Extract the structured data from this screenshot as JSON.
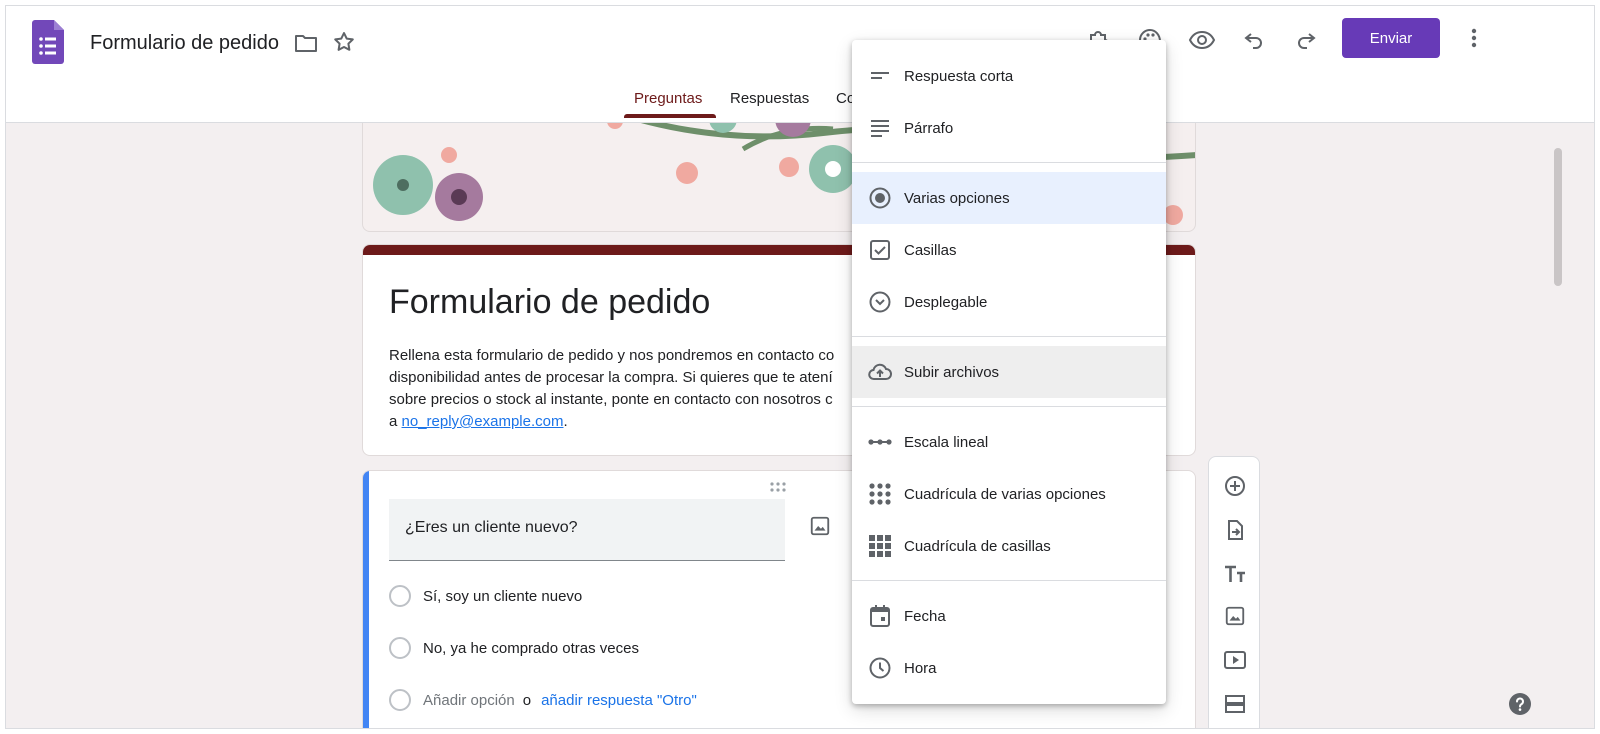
{
  "header": {
    "doc_title": "Formulario de pedido",
    "send_label": "Enviar"
  },
  "tabs": [
    {
      "label": "Preguntas"
    },
    {
      "label": "Respuestas"
    },
    {
      "label": "Co"
    }
  ],
  "form": {
    "title": "Formulario de pedido",
    "description_lines": [
      "Rellena esta formulario de pedido y nos pondremos en contacto co",
      "disponibilidad antes de procesar la compra. Si quieres que te atení",
      "sobre precios o stock al instante, ponte en contacto con nosotros c"
    ],
    "description_prefix": "a ",
    "email": "no_reply@example.com",
    "description_suffix": "."
  },
  "question": {
    "title": "¿Eres un cliente nuevo?",
    "options": [
      "Sí, soy un cliente nuevo",
      "No, ya he comprado otras veces"
    ],
    "add_option": "Añadir opción",
    "or": "o",
    "add_other": "añadir respuesta \"Otro\""
  },
  "menu": {
    "items": [
      {
        "label": "Respuesta corta",
        "icon": "short-answer-icon"
      },
      {
        "label": "Párrafo",
        "icon": "paragraph-icon"
      },
      {
        "label": "Varias opciones",
        "icon": "radio-icon",
        "selected": true
      },
      {
        "label": "Casillas",
        "icon": "checkbox-icon"
      },
      {
        "label": "Desplegable",
        "icon": "dropdown-icon"
      },
      {
        "label": "Subir archivos",
        "icon": "cloud-upload-icon",
        "hover": true
      },
      {
        "label": "Escala lineal",
        "icon": "linear-scale-icon"
      },
      {
        "label": "Cuadrícula de varias opciones",
        "icon": "grid-dots-icon"
      },
      {
        "label": "Cuadrícula de casillas",
        "icon": "grid-squares-icon"
      },
      {
        "label": "Fecha",
        "icon": "calendar-icon"
      },
      {
        "label": "Hora",
        "icon": "clock-icon"
      }
    ]
  },
  "colors": {
    "accent": "#673ab7",
    "theme": "#6d1a1a",
    "link": "#1a73e8",
    "selected_bg": "#e8f0fe",
    "question_bar": "#4285f4"
  }
}
